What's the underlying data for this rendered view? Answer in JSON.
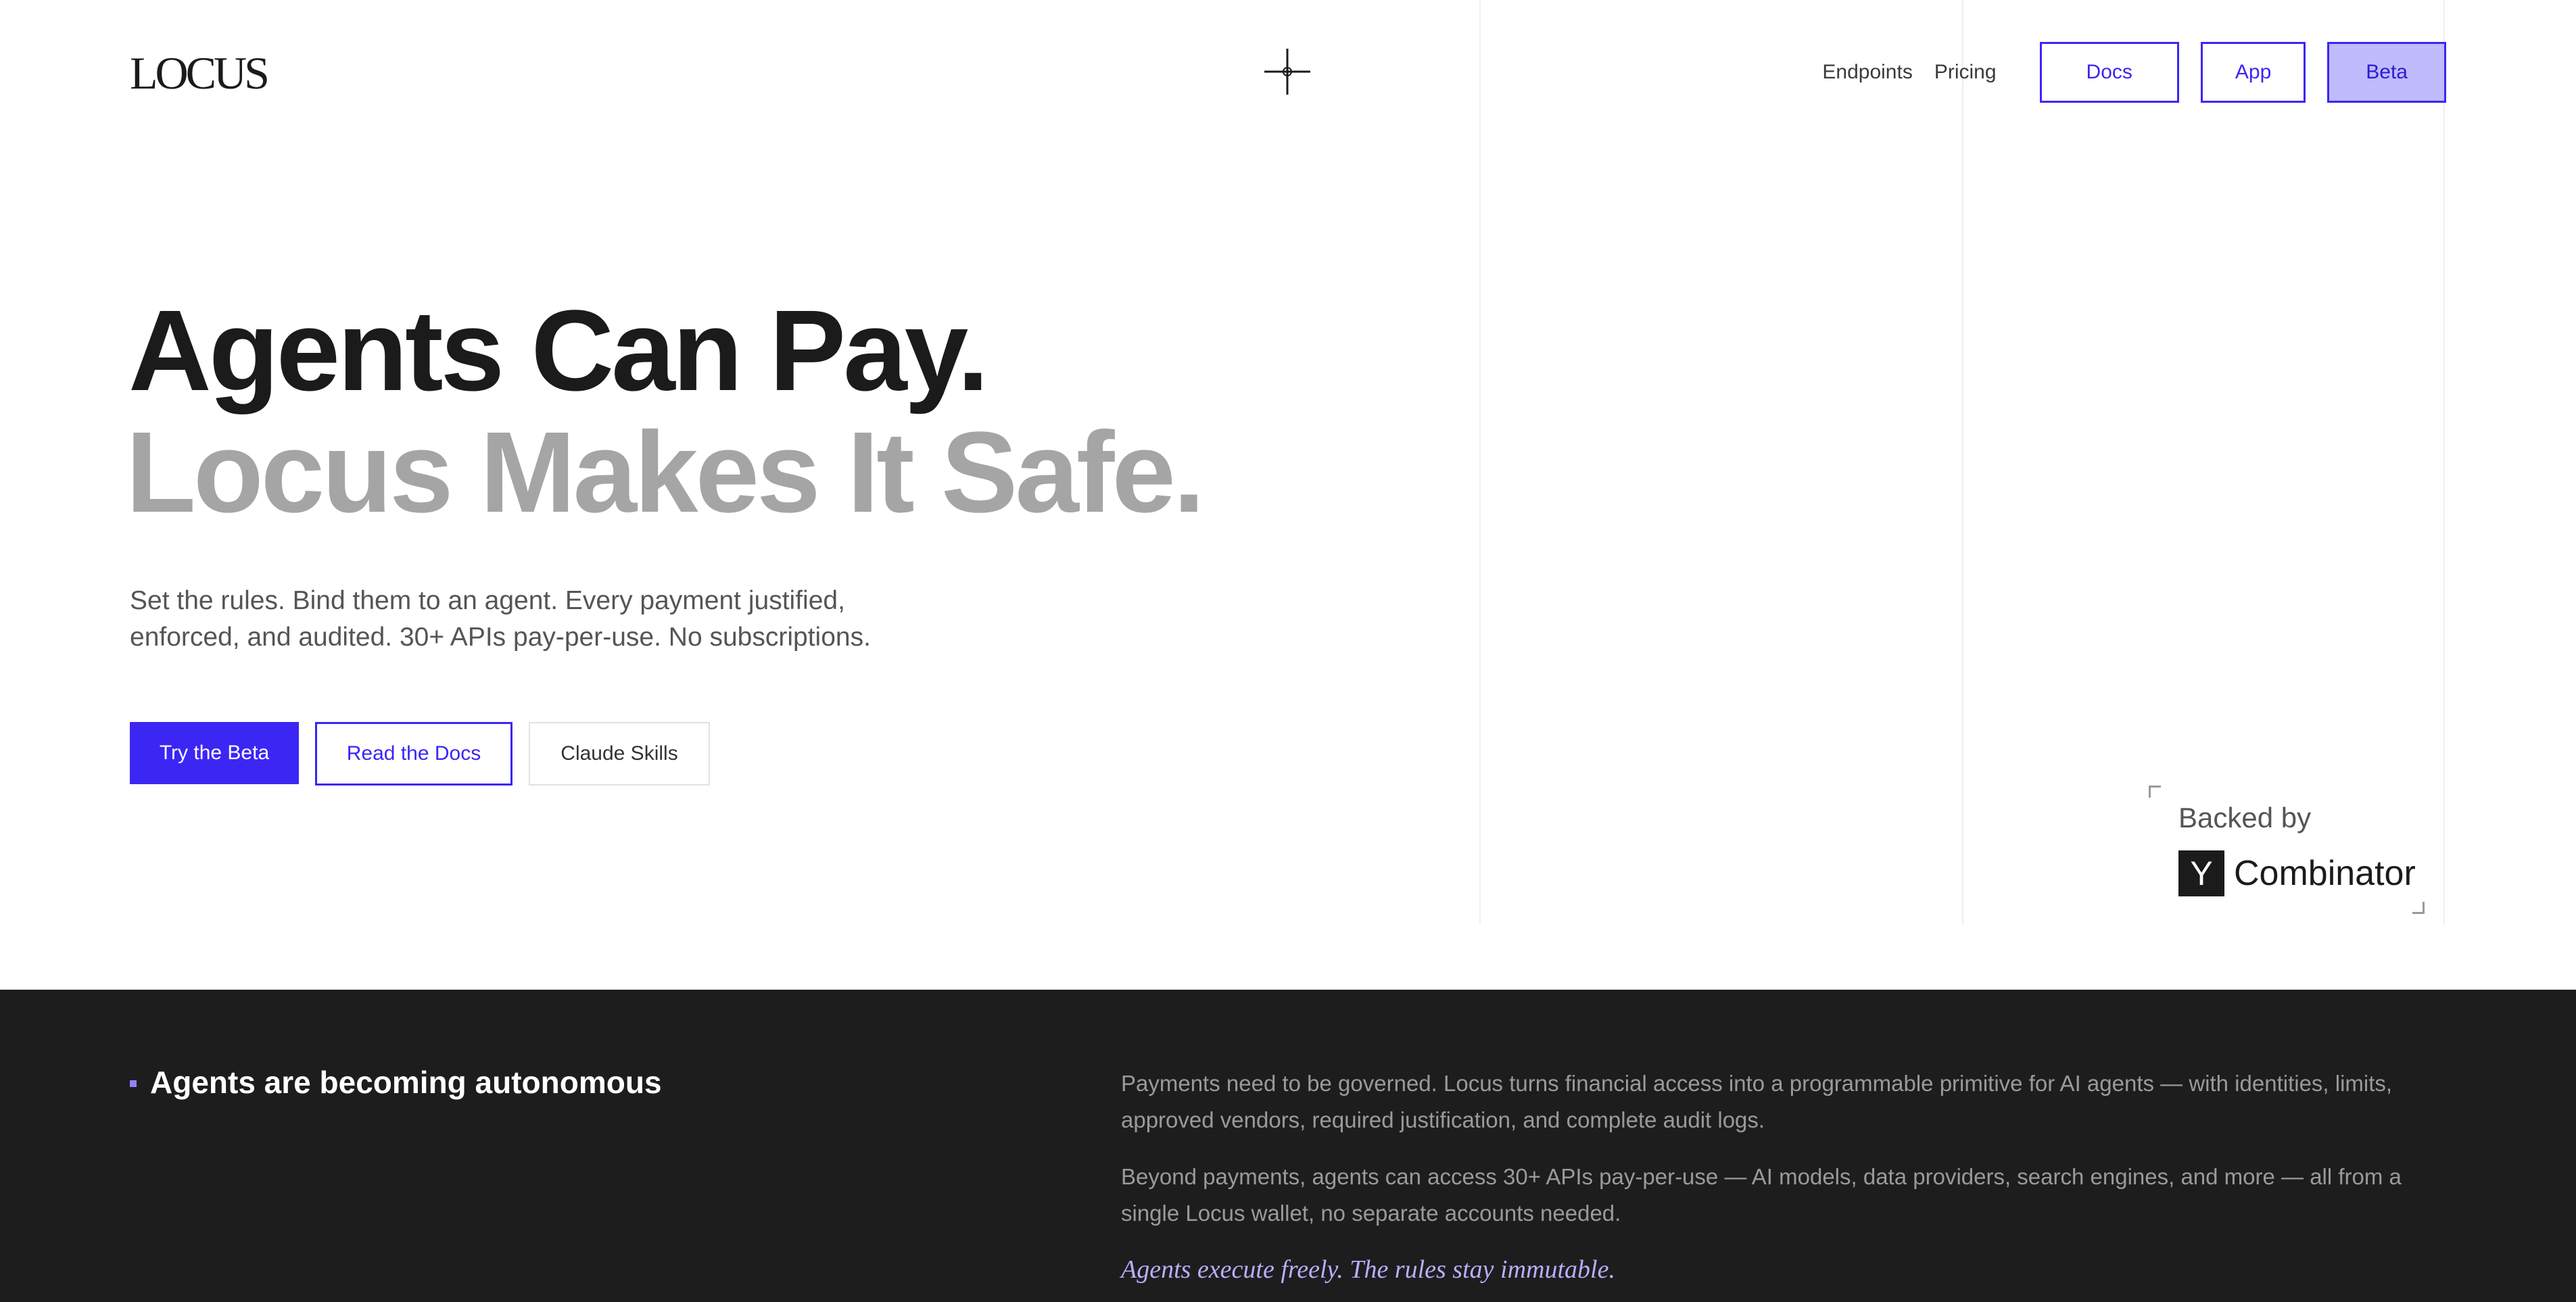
{
  "header": {
    "logo": "LOCUS",
    "nav_links": [
      "Endpoints",
      "Pricing"
    ],
    "nav_buttons": [
      "Docs",
      "App",
      "Beta"
    ]
  },
  "hero": {
    "title": "Agents Can Pay.",
    "subtitle": "Locus Makes It Safe.",
    "description": "Set the rules. Bind them to an agent. Every payment justified, enforced, and audited. 30+ APIs pay-per-use. No subscriptions.",
    "cta_primary": "Try the Beta",
    "cta_docs": "Read the Docs",
    "cta_skills": "Claude Skills"
  },
  "backed": {
    "label": "Backed by",
    "yc_letter": "Y",
    "yc_word": "Combinator"
  },
  "section": {
    "heading": "Agents are becoming autonomous",
    "p1": "Payments need to be governed. Locus turns financial access into a programmable primitive for AI agents — with identities, limits, approved vendors, required justification, and complete audit logs.",
    "p2": "Beyond payments, agents can access 30+ APIs pay-per-use — AI models, data providers, search engines, and more — all from a single Locus wallet, no separate accounts needed.",
    "quote": "Agents execute freely. The rules stay immutable."
  },
  "colors": {
    "accent": "#3b26f4",
    "accent_light": "#c0bbfb",
    "dark_bg": "#1d1d1d",
    "quote": "#b7afff"
  },
  "icons": [
    "crosshair-icon",
    "yc-logo-icon"
  ]
}
